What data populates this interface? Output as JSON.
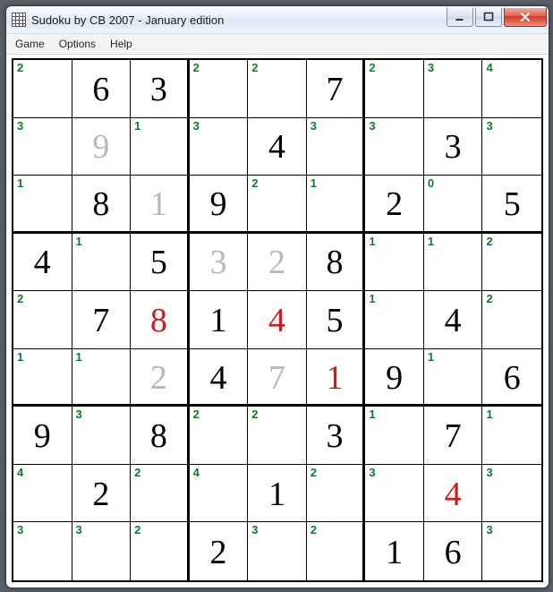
{
  "window": {
    "title": "Sudoku by CB 2007 - January edition",
    "icon_name": "grid-icon"
  },
  "menubar": {
    "items": [
      "Game",
      "Options",
      "Help"
    ]
  },
  "board": {
    "rows": [
      [
        {
          "hint": "2",
          "value": "",
          "color": "black"
        },
        {
          "hint": "",
          "value": "6",
          "color": "black"
        },
        {
          "hint": "",
          "value": "3",
          "color": "black"
        },
        {
          "hint": "2",
          "value": "",
          "color": "black"
        },
        {
          "hint": "2",
          "value": "",
          "color": "black"
        },
        {
          "hint": "",
          "value": "7",
          "color": "black"
        },
        {
          "hint": "2",
          "value": "",
          "color": "black"
        },
        {
          "hint": "3",
          "value": "",
          "color": "black"
        },
        {
          "hint": "4",
          "value": "",
          "color": "black"
        }
      ],
      [
        {
          "hint": "3",
          "value": "",
          "color": "black"
        },
        {
          "hint": "",
          "value": "9",
          "color": "gray"
        },
        {
          "hint": "1",
          "value": "",
          "color": "black"
        },
        {
          "hint": "3",
          "value": "",
          "color": "black"
        },
        {
          "hint": "",
          "value": "4",
          "color": "black"
        },
        {
          "hint": "3",
          "value": "",
          "color": "black"
        },
        {
          "hint": "3",
          "value": "",
          "color": "black"
        },
        {
          "hint": "",
          "value": "3",
          "color": "black"
        },
        {
          "hint": "3",
          "value": "",
          "color": "black"
        }
      ],
      [
        {
          "hint": "1",
          "value": "",
          "color": "black"
        },
        {
          "hint": "",
          "value": "8",
          "color": "black"
        },
        {
          "hint": "",
          "value": "1",
          "color": "gray"
        },
        {
          "hint": "",
          "value": "9",
          "color": "black"
        },
        {
          "hint": "2",
          "value": "",
          "color": "black"
        },
        {
          "hint": "1",
          "value": "",
          "color": "black"
        },
        {
          "hint": "",
          "value": "2",
          "color": "black"
        },
        {
          "hint": "0",
          "value": "",
          "color": "black"
        },
        {
          "hint": "",
          "value": "5",
          "color": "black"
        }
      ],
      [
        {
          "hint": "",
          "value": "4",
          "color": "black"
        },
        {
          "hint": "1",
          "value": "",
          "color": "black"
        },
        {
          "hint": "",
          "value": "5",
          "color": "black"
        },
        {
          "hint": "",
          "value": "3",
          "color": "gray"
        },
        {
          "hint": "",
          "value": "2",
          "color": "gray"
        },
        {
          "hint": "",
          "value": "8",
          "color": "black"
        },
        {
          "hint": "1",
          "value": "",
          "color": "black"
        },
        {
          "hint": "1",
          "value": "",
          "color": "black"
        },
        {
          "hint": "2",
          "value": "",
          "color": "black"
        }
      ],
      [
        {
          "hint": "2",
          "value": "",
          "color": "black"
        },
        {
          "hint": "",
          "value": "7",
          "color": "black"
        },
        {
          "hint": "",
          "value": "8",
          "color": "red"
        },
        {
          "hint": "",
          "value": "1",
          "color": "black"
        },
        {
          "hint": "",
          "value": "4",
          "color": "red"
        },
        {
          "hint": "",
          "value": "5",
          "color": "black"
        },
        {
          "hint": "1",
          "value": "",
          "color": "black"
        },
        {
          "hint": "",
          "value": "4",
          "color": "black"
        },
        {
          "hint": "2",
          "value": "",
          "color": "black"
        }
      ],
      [
        {
          "hint": "1",
          "value": "",
          "color": "black"
        },
        {
          "hint": "1",
          "value": "",
          "color": "black"
        },
        {
          "hint": "",
          "value": "2",
          "color": "gray"
        },
        {
          "hint": "",
          "value": "4",
          "color": "black"
        },
        {
          "hint": "",
          "value": "7",
          "color": "gray"
        },
        {
          "hint": "",
          "value": "1",
          "color": "red"
        },
        {
          "hint": "",
          "value": "9",
          "color": "black"
        },
        {
          "hint": "1",
          "value": "",
          "color": "black"
        },
        {
          "hint": "",
          "value": "6",
          "color": "black"
        }
      ],
      [
        {
          "hint": "",
          "value": "9",
          "color": "black"
        },
        {
          "hint": "3",
          "value": "",
          "color": "black"
        },
        {
          "hint": "",
          "value": "8",
          "color": "black"
        },
        {
          "hint": "2",
          "value": "",
          "color": "black"
        },
        {
          "hint": "2",
          "value": "",
          "color": "black"
        },
        {
          "hint": "",
          "value": "3",
          "color": "black"
        },
        {
          "hint": "1",
          "value": "",
          "color": "black"
        },
        {
          "hint": "",
          "value": "7",
          "color": "black"
        },
        {
          "hint": "1",
          "value": "",
          "color": "black"
        }
      ],
      [
        {
          "hint": "4",
          "value": "",
          "color": "black"
        },
        {
          "hint": "",
          "value": "2",
          "color": "black"
        },
        {
          "hint": "2",
          "value": "",
          "color": "black"
        },
        {
          "hint": "4",
          "value": "",
          "color": "black"
        },
        {
          "hint": "",
          "value": "1",
          "color": "black"
        },
        {
          "hint": "2",
          "value": "",
          "color": "black"
        },
        {
          "hint": "3",
          "value": "",
          "color": "black"
        },
        {
          "hint": "",
          "value": "4",
          "color": "red"
        },
        {
          "hint": "3",
          "value": "",
          "color": "black"
        }
      ],
      [
        {
          "hint": "3",
          "value": "",
          "color": "black"
        },
        {
          "hint": "3",
          "value": "",
          "color": "black"
        },
        {
          "hint": "2",
          "value": "",
          "color": "black"
        },
        {
          "hint": "",
          "value": "2",
          "color": "black"
        },
        {
          "hint": "3",
          "value": "",
          "color": "black"
        },
        {
          "hint": "2",
          "value": "",
          "color": "black"
        },
        {
          "hint": "",
          "value": "1",
          "color": "black"
        },
        {
          "hint": "",
          "value": "6",
          "color": "black"
        },
        {
          "hint": "3",
          "value": "",
          "color": "black"
        }
      ]
    ]
  }
}
